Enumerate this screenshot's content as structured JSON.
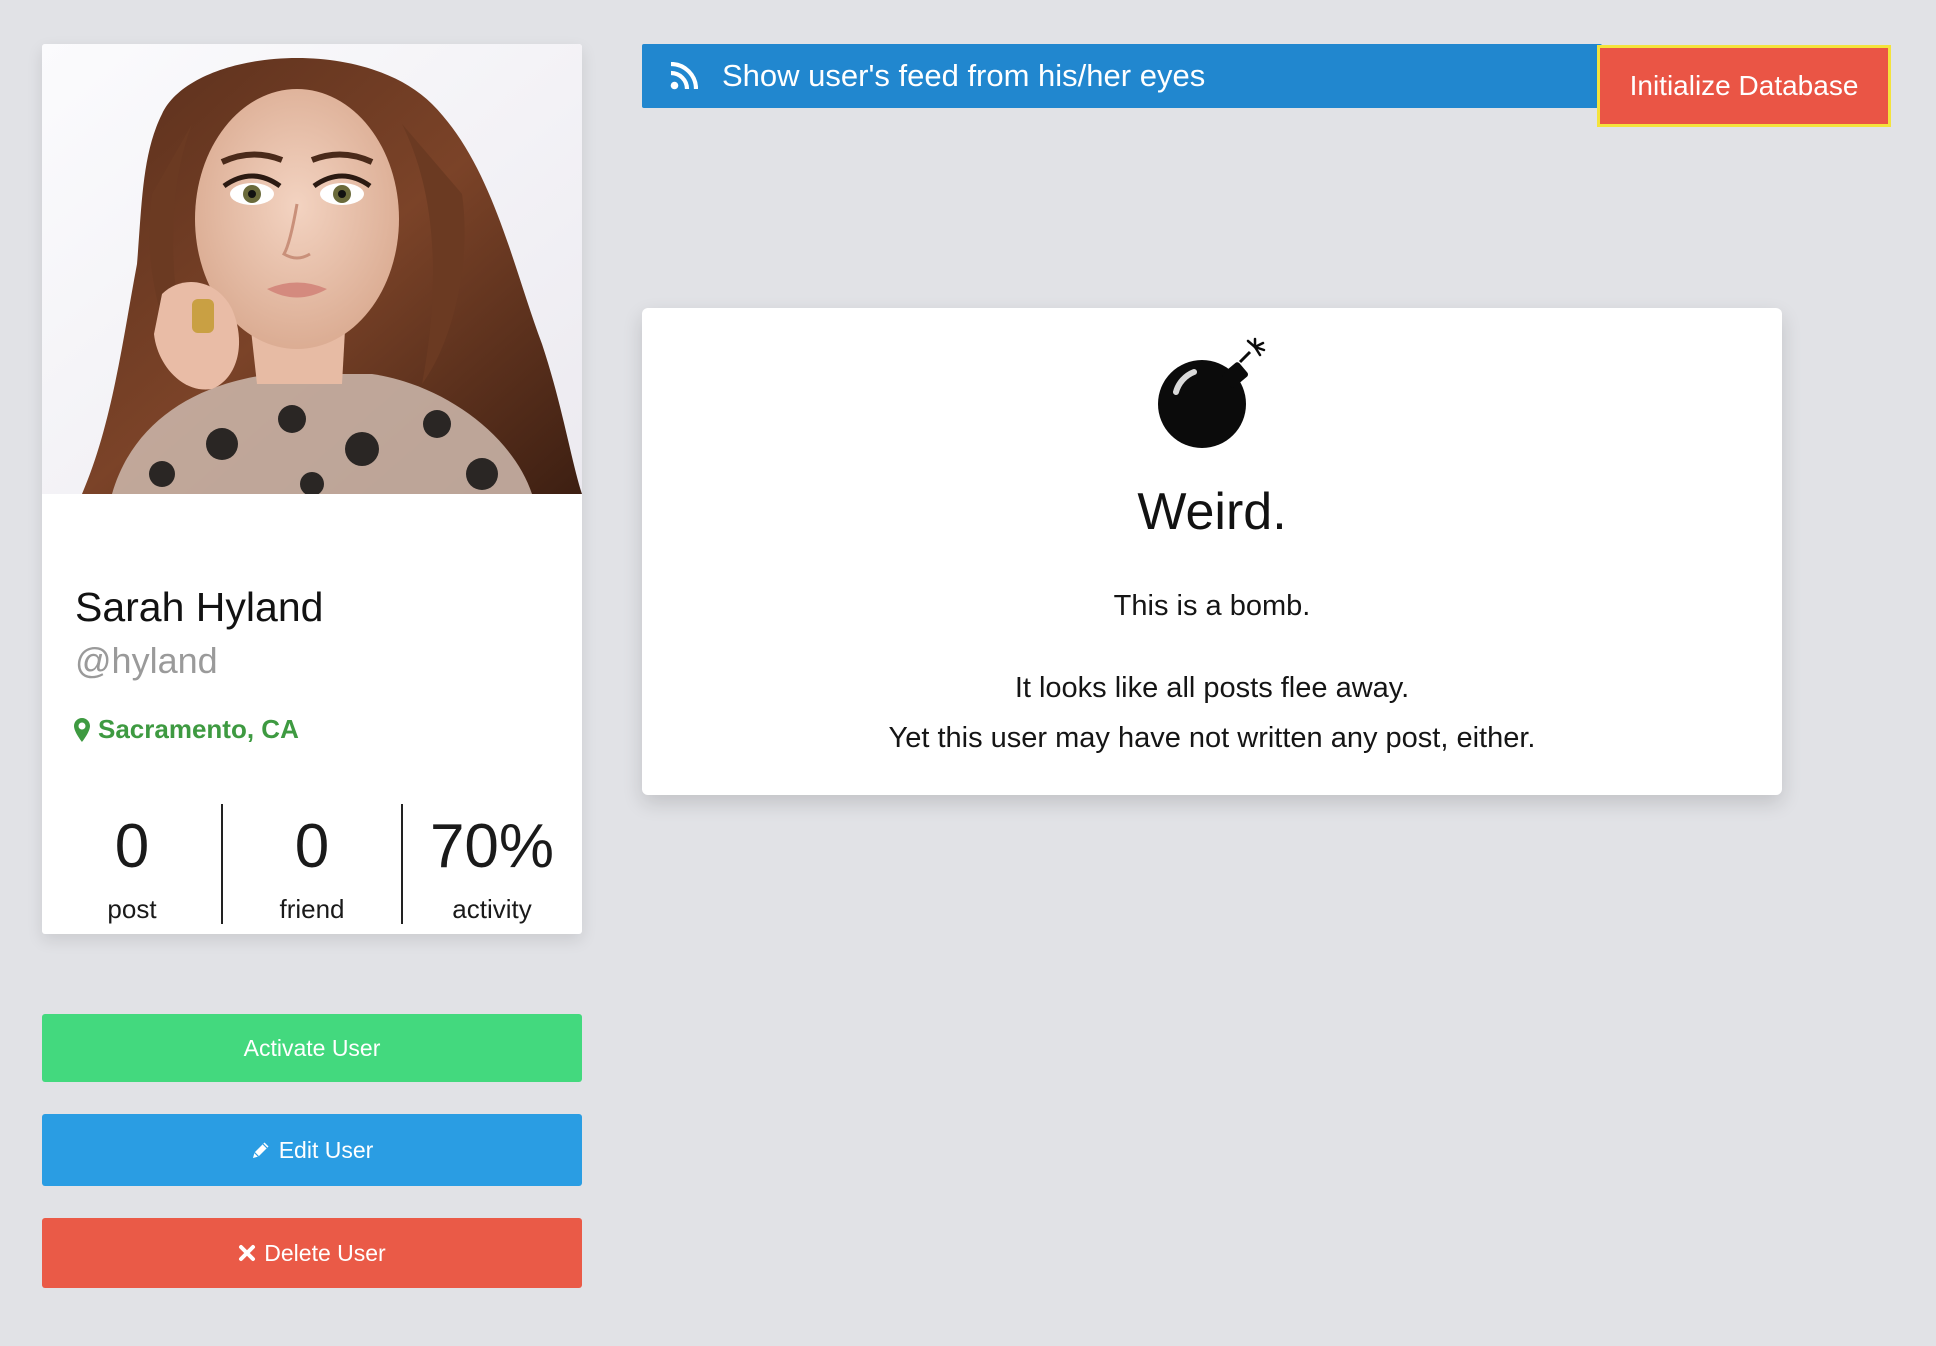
{
  "profile": {
    "name": "Sarah Hyland",
    "handle": "@hyland",
    "location": "Sacramento, CA",
    "stats": [
      {
        "value": "0",
        "label": "post"
      },
      {
        "value": "0",
        "label": "friend"
      },
      {
        "value": "70%",
        "label": "activity"
      }
    ]
  },
  "actions": {
    "activate_label": "Activate User",
    "edit_label": "Edit User",
    "delete_label": "Delete User"
  },
  "feed_bar": {
    "label": "Show user's feed from his/her eyes"
  },
  "init_button": {
    "label": "Initialize Database"
  },
  "empty_state": {
    "title": "Weird.",
    "line1": "This is a bomb.",
    "line2": "It looks like all posts flee away.",
    "line3": "Yet this user may have not written any post, either."
  },
  "icons": {
    "feed": "rss-icon",
    "location": "map-marker-icon",
    "edit": "pencil-icon",
    "delete": "times-icon",
    "empty": "bomb-icon"
  },
  "colors": {
    "background": "#e1e2e6",
    "feed_bar": "#2187cf",
    "init_button": "#ea5545",
    "init_border": "#f4e33c",
    "activate": "#43d97e",
    "edit": "#2a9de3",
    "delete": "#ea5a47",
    "location": "#3e9a41"
  }
}
